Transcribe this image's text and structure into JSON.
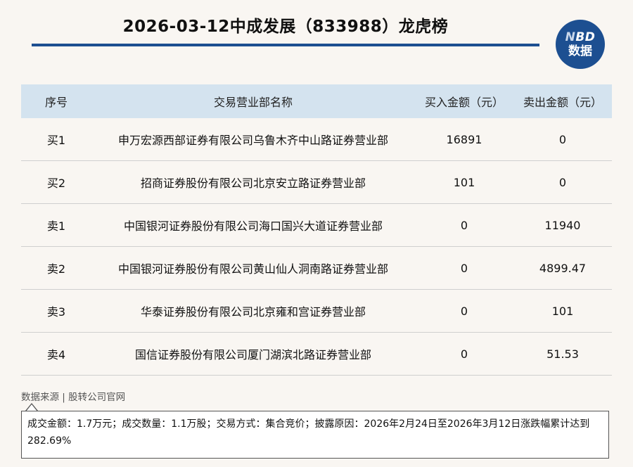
{
  "title": "2026-03-12中成发展（833988）龙虎榜",
  "logo": {
    "line1_n": "N",
    "line1_rest": "BD",
    "line2": "数据"
  },
  "table": {
    "headers": [
      "序号",
      "交易营业部名称",
      "买入金额（元）",
      "卖出金额（元）"
    ],
    "rows": [
      [
        "买1",
        "申万宏源西部证券有限公司乌鲁木齐中山路证券营业部",
        "16891",
        "0"
      ],
      [
        "买2",
        "招商证券股份有限公司北京安立路证券营业部",
        "101",
        "0"
      ],
      [
        "卖1",
        "中国银河证券股份有限公司海口国兴大道证券营业部",
        "0",
        "11940"
      ],
      [
        "卖2",
        "中国银河证券股份有限公司黄山仙人洞南路证券营业部",
        "0",
        "4899.47"
      ],
      [
        "卖3",
        "华泰证券股份有限公司北京雍和宫证券营业部",
        "0",
        "101"
      ],
      [
        "卖4",
        "国信证券股份有限公司厦门湖滨北路证券营业部",
        "0",
        "51.53"
      ]
    ]
  },
  "source": "数据来源 | 股转公司官网",
  "note": "成交金额：1.7万元；成交数量：1.1万股；交易方式：集合竞价；披露原因：2026年2月24日至2026年3月12日涨跌幅累计达到282.69%",
  "colors": {
    "brand": "#1d4f91",
    "header_bg": "#d4e3ef",
    "background": "#f9f6f2"
  }
}
